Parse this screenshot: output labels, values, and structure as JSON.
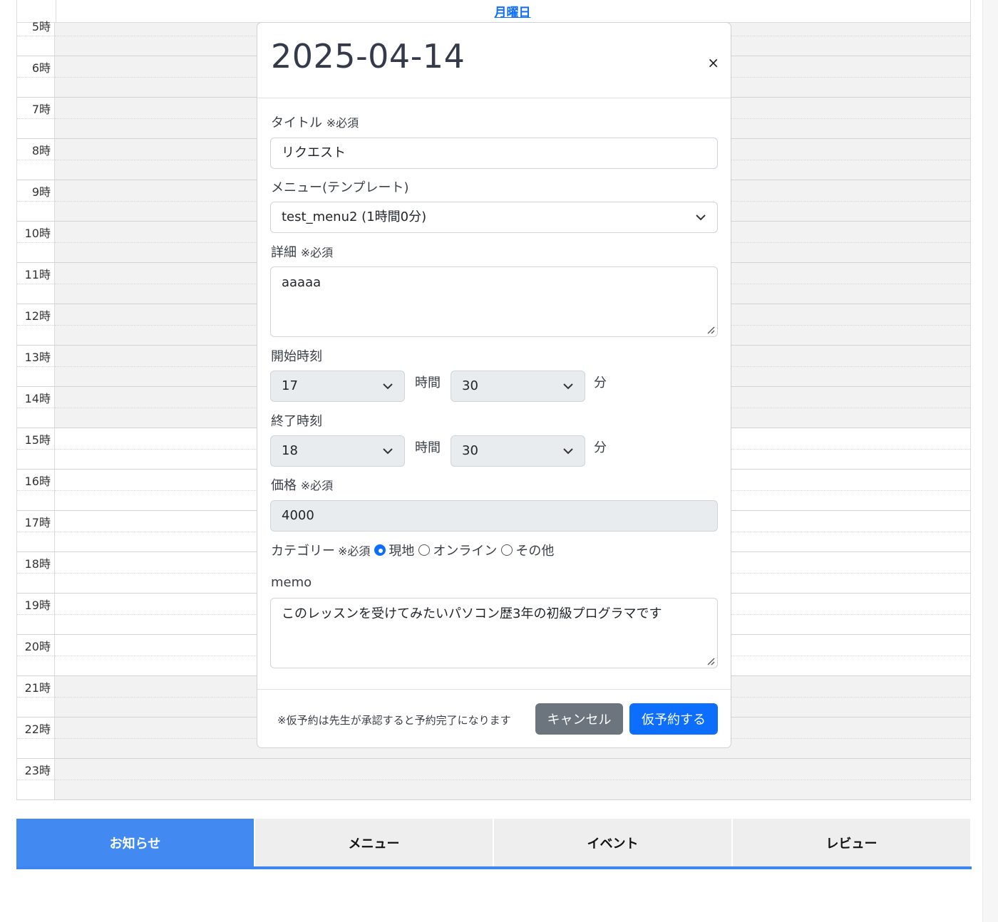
{
  "calendar": {
    "day_header": "月曜日",
    "hours": [
      {
        "label": "5時",
        "open": false
      },
      {
        "label": "6時",
        "open": false
      },
      {
        "label": "7時",
        "open": false
      },
      {
        "label": "8時",
        "open": false
      },
      {
        "label": "9時",
        "open": false
      },
      {
        "label": "10時",
        "open": false
      },
      {
        "label": "11時",
        "open": false
      },
      {
        "label": "12時",
        "open": false
      },
      {
        "label": "13時",
        "open": false
      },
      {
        "label": "14時",
        "open": false
      },
      {
        "label": "15時",
        "open": true
      },
      {
        "label": "16時",
        "open": true
      },
      {
        "label": "17時",
        "open": true
      },
      {
        "label": "18時",
        "open": true
      },
      {
        "label": "19時",
        "open": true
      },
      {
        "label": "20時",
        "open": true
      },
      {
        "label": "21時",
        "open": false
      },
      {
        "label": "22時",
        "open": false
      },
      {
        "label": "23時",
        "open": false
      }
    ]
  },
  "tabs": [
    {
      "label": "お知らせ",
      "active": true
    },
    {
      "label": "メニュー",
      "active": false
    },
    {
      "label": "イベント",
      "active": false
    },
    {
      "label": "レビュー",
      "active": false
    }
  ],
  "modal": {
    "title": "2025-04-14",
    "close": "×",
    "required_mark": "※必須",
    "title_label": "タイトル",
    "title_value": "リクエスト",
    "menu_label": "メニュー(テンプレート)",
    "menu_value": "test_menu2 (1時間0分)",
    "detail_label": "詳細",
    "detail_value": "aaaaa",
    "start_label": "開始時刻",
    "start_hour": "17",
    "start_minute": "30",
    "end_label": "終了時刻",
    "end_hour": "18",
    "end_minute": "30",
    "hour_unit": "時間",
    "minute_unit": "分",
    "price_label": "価格",
    "price_value": "4000",
    "category_label": "カテゴリー",
    "category_options": [
      {
        "label": "現地",
        "checked": true
      },
      {
        "label": "オンライン",
        "checked": false
      },
      {
        "label": "その他",
        "checked": false
      }
    ],
    "memo_label": "memo",
    "memo_value": "このレッスンを受けてみたいパソコン歴3年の初級プログラマです",
    "footer_note": "※仮予約は先生が承認すると予約完了になります",
    "cancel_label": "キャンセル",
    "submit_label": "仮予約する"
  },
  "colors": {
    "primary": "#0d6efd",
    "secondary": "#6c757d",
    "tab_active": "#4289f1",
    "closed_slot": "#f2f2f2"
  }
}
